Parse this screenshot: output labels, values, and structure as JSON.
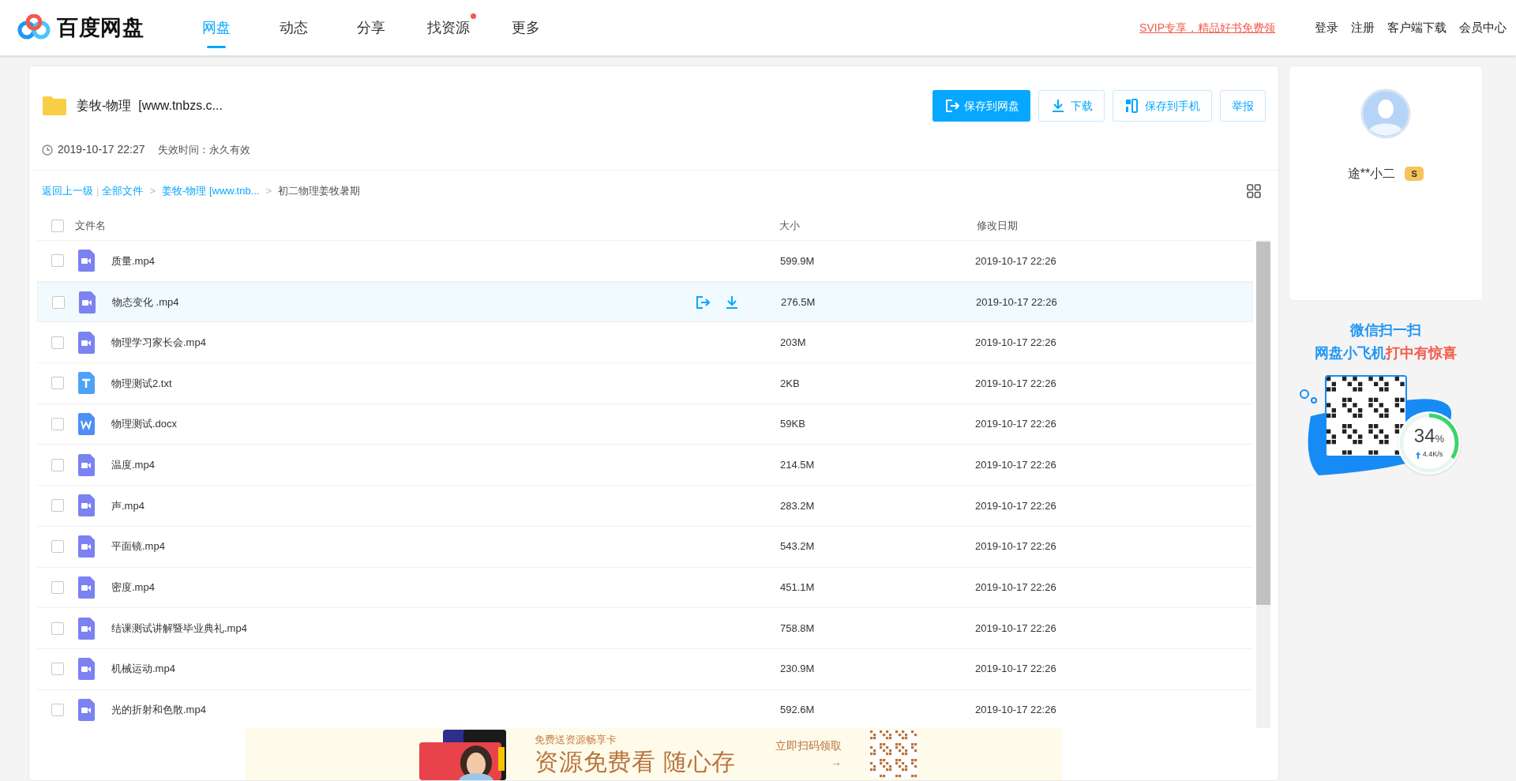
{
  "header": {
    "logo": "百度网盘",
    "nav": [
      {
        "label": "网盘",
        "selected": true,
        "dot": false
      },
      {
        "label": "动态",
        "selected": false,
        "dot": false
      },
      {
        "label": "分享",
        "selected": false,
        "dot": false
      },
      {
        "label": "找资源",
        "selected": false,
        "dot": true
      },
      {
        "label": "更多",
        "selected": false,
        "dot": false
      }
    ],
    "promo": "SVIP专享，精品好书免费领",
    "links": [
      "登录",
      "注册",
      "客户端下载",
      "会员中心"
    ]
  },
  "share": {
    "title": "姜牧-物理  [www.tnbzs.c...",
    "time": "2019-10-17 22:27",
    "expiry": "失效时间：永久有效",
    "buttons": [
      {
        "label": "保存到网盘",
        "kind": "save",
        "primary": true
      },
      {
        "label": "下载",
        "kind": "download",
        "primary": false
      },
      {
        "label": "保存到手机",
        "kind": "phone",
        "primary": false
      },
      {
        "label": "举报",
        "kind": "report",
        "primary": false
      }
    ]
  },
  "breadcrumb": {
    "back": "返回上一级",
    "divider": "|",
    "items": [
      {
        "label": "全部文件",
        "link": true
      },
      {
        "separator": ">",
        "label": "姜牧-物理 [www.tnb...",
        "link": true
      },
      {
        "separator": ">",
        "label": "初二物理姜牧暑期",
        "link": false
      }
    ]
  },
  "table": {
    "select_all_checked": false,
    "columns": [
      "文件名",
      "大小",
      "修改日期"
    ],
    "rows": [
      {
        "name": "质量.mp4",
        "kind": "video",
        "size": "599.9M",
        "date": "2019-10-17 22:26",
        "hovered": false,
        "checked": false
      },
      {
        "name": "物态变化 .mp4",
        "kind": "video",
        "size": "276.5M",
        "date": "2019-10-17 22:26",
        "hovered": true,
        "checked": false
      },
      {
        "name": "物理学习家长会.mp4",
        "kind": "video",
        "size": "203M",
        "date": "2019-10-17 22:26",
        "hovered": false,
        "checked": false
      },
      {
        "name": "物理测试2.txt",
        "kind": "text",
        "size": "2KB",
        "date": "2019-10-17 22:26",
        "hovered": false,
        "checked": false
      },
      {
        "name": "物理测试.docx",
        "kind": "word",
        "size": "59KB",
        "date": "2019-10-17 22:26",
        "hovered": false,
        "checked": false
      },
      {
        "name": "温度.mp4",
        "kind": "video",
        "size": "214.5M",
        "date": "2019-10-17 22:26",
        "hovered": false,
        "checked": false
      },
      {
        "name": "声.mp4",
        "kind": "video",
        "size": "283.2M",
        "date": "2019-10-17 22:26",
        "hovered": false,
        "checked": false
      },
      {
        "name": "平面镜.mp4",
        "kind": "video",
        "size": "543.2M",
        "date": "2019-10-17 22:26",
        "hovered": false,
        "checked": false
      },
      {
        "name": "密度.mp4",
        "kind": "video",
        "size": "451.1M",
        "date": "2019-10-17 22:26",
        "hovered": false,
        "checked": false
      },
      {
        "name": "结课测试讲解暨毕业典礼.mp4",
        "kind": "video",
        "size": "758.8M",
        "date": "2019-10-17 22:26",
        "hovered": false,
        "checked": false
      },
      {
        "name": "机械运动.mp4",
        "kind": "video",
        "size": "230.9M",
        "date": "2019-10-17 22:26",
        "hovered": false,
        "checked": false
      },
      {
        "name": "光的折射和色散.mp4",
        "kind": "video",
        "size": "592.6M",
        "date": "2019-10-17 22:26",
        "hovered": false,
        "checked": false
      }
    ]
  },
  "banner": {
    "subtitle": "免费送资源畅享卡",
    "headline": "资源免费看 随心存",
    "cta": "立即扫码领取",
    "arrow": "→"
  },
  "user": {
    "name": "途**小二",
    "badge": "S"
  },
  "promo_card": {
    "line1": "微信扫一扫",
    "line2_blue": "网盘小飞机",
    "line2_red": "打中有惊喜"
  },
  "speed": {
    "percent": "34",
    "unit": "%",
    "rate": "4.4K/s",
    "level": 0.34
  }
}
